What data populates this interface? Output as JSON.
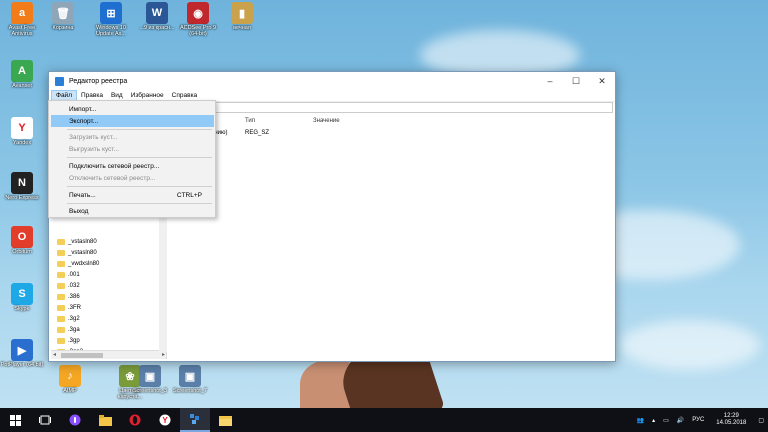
{
  "desktop": {
    "icons": [
      {
        "label": "Avast Free Antivirus",
        "color": "#f27b1a",
        "glyph": "a"
      },
      {
        "label": "Корзина",
        "color": "#8fa6b8",
        "glyph": "🗑"
      },
      {
        "label": "Windows 10 Update As...",
        "color": "#1f6fd1",
        "glyph": "⊞"
      },
      {
        "label": "...9 из красн...",
        "color": "#2b5796",
        "glyph": "W"
      },
      {
        "label": "ACDSee Pro 9 (64-bit)",
        "color": "#c0282d",
        "glyph": "◉"
      },
      {
        "label": "вечная",
        "color": "#caa24b",
        "glyph": "▮"
      },
      {
        "label": "Avanset",
        "color": "#3aa850",
        "glyph": "A"
      },
      {
        "label": "Yandex",
        "color": "#ffffff",
        "glyph": "Y"
      },
      {
        "label": "Nero Express",
        "color": "#222222",
        "glyph": "N"
      },
      {
        "label": "Orbitum",
        "color": "#e23c2a",
        "glyph": "O"
      },
      {
        "label": "Skype",
        "color": "#1ea8e6",
        "glyph": "S"
      },
      {
        "label": "PotPlayer (64 bit)",
        "color": "#2a6fd0",
        "glyph": "▶"
      },
      {
        "label": "AIMP",
        "color": "#f5a623",
        "glyph": "♪"
      },
      {
        "label": "Цветная капуста...",
        "color": "#7a9b3a",
        "glyph": "❀"
      },
      {
        "label": "Screenshot_3",
        "color": "#5a7fa8",
        "glyph": "▣"
      },
      {
        "label": "Screenshot_7",
        "color": "#5a7fa8",
        "glyph": "▣"
      }
    ]
  },
  "window": {
    "title": "Редактор реестра",
    "minimize": "–",
    "maximize": "☐",
    "close": "✕"
  },
  "menubar": {
    "items": [
      "Файл",
      "Правка",
      "Вид",
      "Избранное",
      "Справка"
    ]
  },
  "file_menu": {
    "items": [
      {
        "label": "Импорт...",
        "disabled": false
      },
      {
        "label": "Экспорт...",
        "disabled": false,
        "highlight": true
      },
      {
        "label": "Загрузить куст...",
        "disabled": true
      },
      {
        "label": "Выгрузить куст...",
        "disabled": true
      },
      {
        "label": "Подключить сетевой реестр...",
        "disabled": false
      },
      {
        "label": "Отключить сетевой реестр...",
        "disabled": true
      },
      {
        "label": "Печать...",
        "shortcut": "CTRL+P",
        "disabled": false
      },
      {
        "label": "Выход",
        "disabled": false
      }
    ]
  },
  "tree": {
    "items": [
      "_vstasln80",
      "_vstasln80",
      "_vwdxsln80",
      ".001",
      ".032",
      ".386",
      ".3FR",
      ".3g2",
      ".3ga",
      ".3gp",
      ".3gp2",
      ".3gpp",
      ".3mf",
      ".7z"
    ]
  },
  "list": {
    "headers": [
      "Тип",
      "Значение"
    ],
    "row": {
      "name_fragment": "анию)",
      "type": "REG_SZ",
      "value": ""
    }
  },
  "taskbar": {
    "clock_time": "12:29",
    "clock_date": "14.05.2018",
    "language": "РУС"
  }
}
